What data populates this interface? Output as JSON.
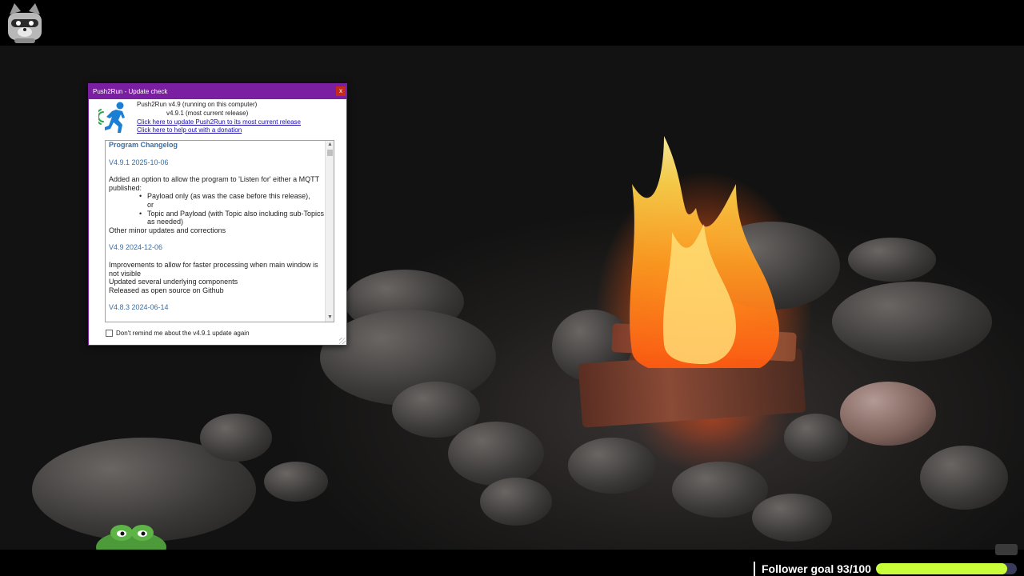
{
  "dialog": {
    "title": "Push2Run - Update check",
    "close_glyph": "x",
    "version_running": "Push2Run v4.9 (running on this computer)",
    "version_current": "v4.9.1 (most current release)",
    "update_link": "Click here to update Push2Run to its most current release",
    "donate_link": "Click here to help out with a donation",
    "changelog": {
      "title": "Program Changelog",
      "entries": [
        {
          "version": "V4.9.1 2025-10-06",
          "lines": [
            "Added an option to allow the program to 'Listen for' either a MQTT published:"
          ],
          "bullets": [
            {
              "text": "Payload only (as was the case before this release),",
              "cont": "or"
            },
            {
              "text": "Topic and Payload (with Topic also including sub-Topics as needed)",
              "cont": ""
            }
          ],
          "after": [
            "Other minor updates and corrections"
          ]
        },
        {
          "version": "V4.9 2024-12-06",
          "lines": [
            "Improvements to allow for faster processing when main window is not visible",
            "Updated several underlying components",
            "Released as open source on Github"
          ]
        },
        {
          "version": "V4.8.3 2024-06-14",
          "lines": []
        }
      ]
    },
    "remind_label": "Don't remind me about the v4.9.1 update again",
    "remind_checked": false
  },
  "overlay": {
    "follower_goal_text": "Follower goal 93/100",
    "follower_current": 93,
    "follower_target": 100,
    "progress_color": "#c8ff3a"
  },
  "colors": {
    "titlebar": "#7a1fa2",
    "close_button": "#c42b1c",
    "link": "#1a0dab",
    "changelog_heading": "#3a6ea5"
  },
  "icons": {
    "app_icon": "running-person-icon",
    "mascot": "raccoon-mascot-icon",
    "frog": "frog-emote-icon"
  }
}
